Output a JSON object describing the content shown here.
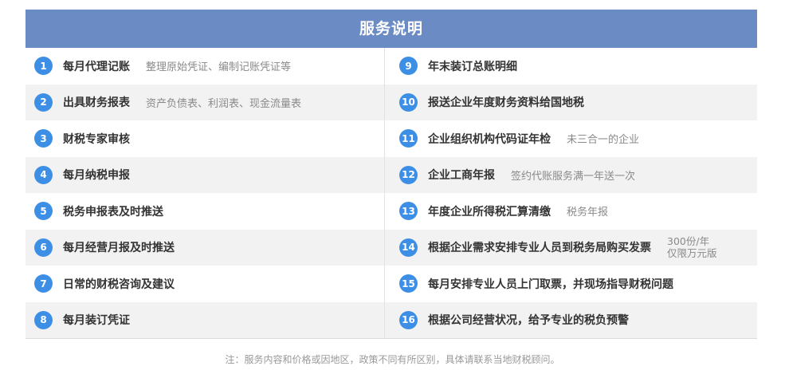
{
  "header": {
    "title": "服务说明"
  },
  "services": [
    {
      "num": "1",
      "label": "每月代理记账",
      "note": "整理原始凭证、编制记账凭证等"
    },
    {
      "num": "2",
      "label": "出具财务报表",
      "note": "资产负债表、利润表、现金流量表"
    },
    {
      "num": "3",
      "label": "财税专家审核",
      "note": ""
    },
    {
      "num": "4",
      "label": "每月纳税申报",
      "note": ""
    },
    {
      "num": "5",
      "label": "税务申报表及时推送",
      "note": ""
    },
    {
      "num": "6",
      "label": "每月经营月报及时推送",
      "note": ""
    },
    {
      "num": "7",
      "label": "日常的财税咨询及建议",
      "note": ""
    },
    {
      "num": "8",
      "label": "每月装订凭证",
      "note": ""
    },
    {
      "num": "9",
      "label": "年末装订总账明细",
      "note": ""
    },
    {
      "num": "10",
      "label": "报送企业年度财务资料给国地税",
      "note": ""
    },
    {
      "num": "11",
      "label": "企业组织机构代码证年检",
      "note": "未三合一的企业"
    },
    {
      "num": "12",
      "label": "企业工商年报",
      "note": "签约代账服务满一年送一次"
    },
    {
      "num": "13",
      "label": "年度企业所得税汇算清缴",
      "note": "税务年报"
    },
    {
      "num": "14",
      "label": "根据企业需求安排专业人员到税务局购买发票",
      "note_line1": "300份/年",
      "note_line2": "仅限万元版"
    },
    {
      "num": "15",
      "label": "每月安排专业人员上门取票，并现场指导财税问题",
      "note": ""
    },
    {
      "num": "16",
      "label": "根据公司经营状况，给予专业的税负预警",
      "note": ""
    }
  ],
  "footer": {
    "text": "注：服务内容和价格或因地区，政策不同有所区别，具体请联系当地财税顾问。"
  },
  "colors": {
    "header_bg": "#6b8bc5",
    "badge": "#3d8fe6",
    "row_alt": "#f2f2f2"
  }
}
